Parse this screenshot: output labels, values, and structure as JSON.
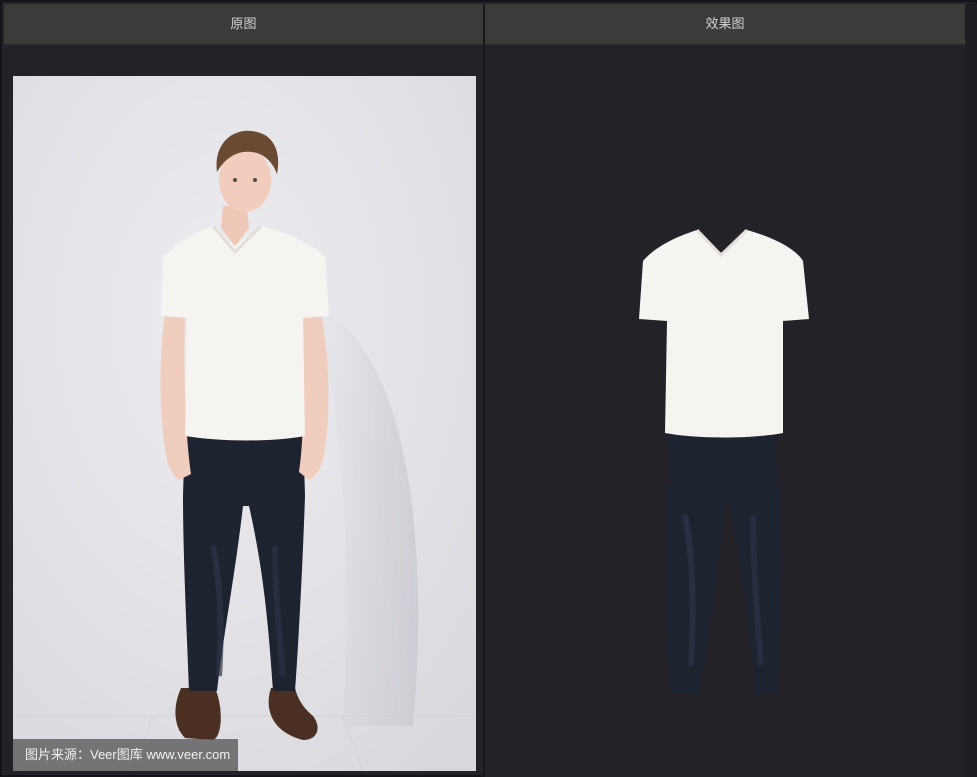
{
  "panels": {
    "original": {
      "title": "原图"
    },
    "result": {
      "title": "效果图"
    }
  },
  "caption": {
    "text": "图片来源：Veer图库 www.veer.com"
  },
  "colors": {
    "header_bg": "#3b3b3c",
    "panel_bg": "#232228",
    "photo_bg": "#e3e3e7",
    "shirt": "#f6f4f1",
    "jeans": "#1e2330",
    "shoes": "#4a2f22"
  }
}
